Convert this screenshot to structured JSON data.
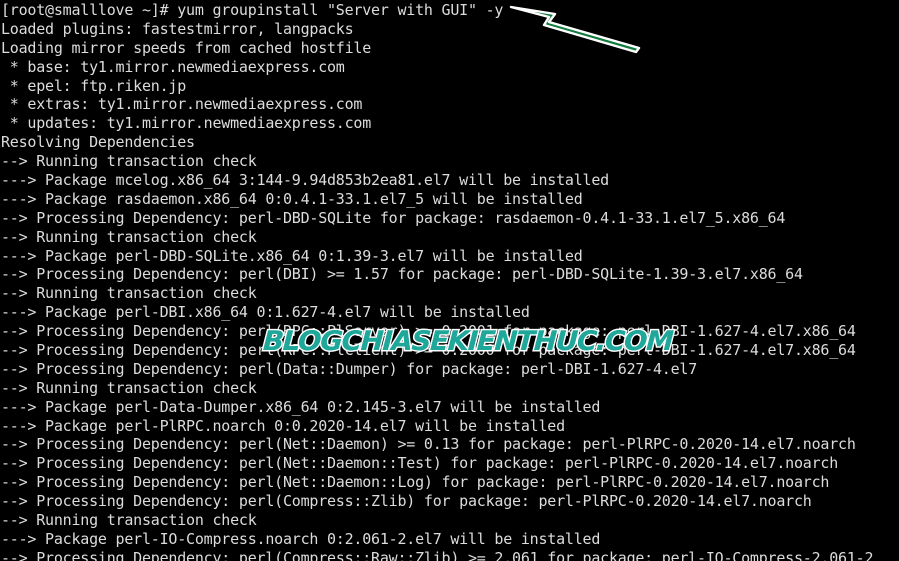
{
  "terminal": {
    "background_color": "#000000",
    "text_color": "#dcdcdc",
    "prompt": "[root@smalllove ~]#",
    "command": "yum groupinstall \"Server with GUI\" -y",
    "lines": [
      "[root@smalllove ~]# yum groupinstall \"Server with GUI\" -y",
      "Loaded plugins: fastestmirror, langpacks",
      "Loading mirror speeds from cached hostfile",
      " * base: ty1.mirror.newmediaexpress.com",
      " * epel: ftp.riken.jp",
      " * extras: ty1.mirror.newmediaexpress.com",
      " * updates: ty1.mirror.newmediaexpress.com",
      "Resolving Dependencies",
      "--> Running transaction check",
      "---> Package mcelog.x86_64 3:144-9.94d853b2ea81.el7 will be installed",
      "---> Package rasdaemon.x86_64 0:0.4.1-33.1.el7_5 will be installed",
      "--> Processing Dependency: perl-DBD-SQLite for package: rasdaemon-0.4.1-33.1.el7_5.x86_64",
      "--> Running transaction check",
      "---> Package perl-DBD-SQLite.x86_64 0:1.39-3.el7 will be installed",
      "--> Processing Dependency: perl(DBI) >= 1.57 for package: perl-DBD-SQLite-1.39-3.el7.x86_64",
      "--> Running transaction check",
      "---> Package perl-DBI.x86_64 0:1.627-4.el7 will be installed",
      "--> Processing Dependency: perl(RPC::PlServer) >= 0.2001 for package: perl-DBI-1.627-4.el7.x86_64",
      "--> Processing Dependency: perl(RPC::PlClient) >= 0.2000 for package: perl-DBI-1.627-4.el7.x86_64",
      "--> Processing Dependency: perl(Data::Dumper) for package: perl-DBI-1.627-4.el7",
      "--> Running transaction check",
      "---> Package perl-Data-Dumper.x86_64 0:2.145-3.el7 will be installed",
      "---> Package perl-PlRPC.noarch 0:0.2020-14.el7 will be installed",
      "--> Processing Dependency: perl(Net::Daemon) >= 0.13 for package: perl-PlRPC-0.2020-14.el7.noarch",
      "--> Processing Dependency: perl(Net::Daemon::Test) for package: perl-PlRPC-0.2020-14.el7.noarch",
      "--> Processing Dependency: perl(Net::Daemon::Log) for package: perl-PlRPC-0.2020-14.el7.noarch",
      "--> Processing Dependency: perl(Compress::Zlib) for package: perl-PlRPC-0.2020-14.el7.noarch",
      "--> Running transaction check",
      "---> Package perl-IO-Compress.noarch 0:2.061-2.el7 will be installed",
      "--> Processing Dependency: perl(Compress::Raw::Zlib) >= 2.061 for package: perl-IO-Compress-2.061-2"
    ]
  },
  "annotations": {
    "arrow": {
      "color": "#117a3d",
      "outline_color": "#ffffff",
      "points_to": "-y"
    },
    "watermark": {
      "text": "BLOGCHIASEKIENTHUC.COM",
      "color": "#1fa89a",
      "outline_color": "#ffffff"
    }
  }
}
